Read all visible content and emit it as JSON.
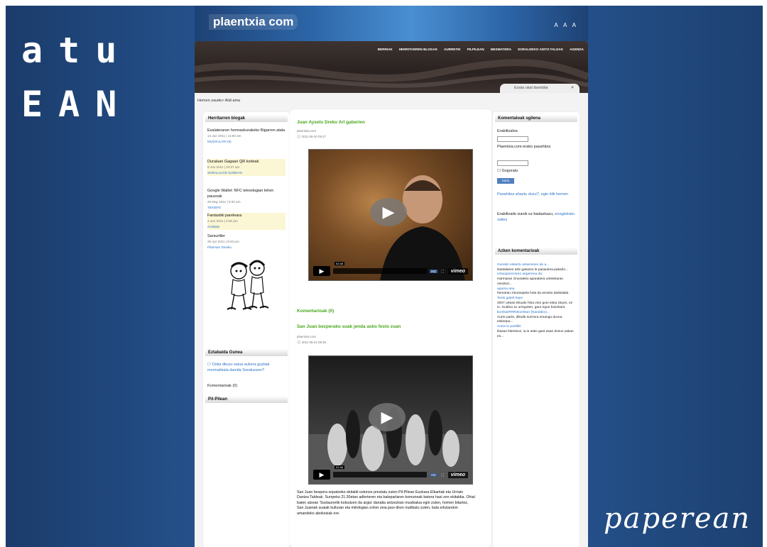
{
  "brand": {
    "line1": "atu",
    "line2": "EAN",
    "tagline": "paperean"
  },
  "header": {
    "logo": "plaentxia com",
    "textsize": "A A A"
  },
  "nav": [
    "BERRIAK",
    "HERRITARREN BLOGAK",
    "AURRETIK",
    "PILPILEAN",
    "MESMATERA",
    "SORALDEKO ADITZ-TALDAK",
    "AGENDA"
  ],
  "search": {
    "placeholder": "Ezata ukal danistlar"
  },
  "breadcrumb": "Hemen zaude> Aldi ama",
  "left": {
    "blogs_title": "Herritarren blogak",
    "posts": [
      {
        "title": "Esalateraren hormaskurakeko Bigarren atala",
        "date": "14 Jun 2011 | 11:00 am",
        "link": "MUSSULARI (5)",
        "hl": false
      },
      {
        "title": "Duralaan Gagaan QR kodeak",
        "date": "9 Jun 2011 | 10:37 am",
        "link": "SORALLUCE GUNEAN",
        "hl": true
      },
      {
        "title": "Google Wallet: NFC teknologian lehen pausoak",
        "date": "26 May 2011 | 8:30 am",
        "link": "TEKIEFE",
        "hl": false
      },
      {
        "title": "Fantastiki pareleara",
        "date": "3 Jun 2011 | 4:00 pm",
        "link": "Arrakiati",
        "hl": true
      },
      {
        "title": "Sarsurtiler",
        "date": "25 Apr 2011 | 8:40 pm",
        "link": "Pilarmas Tanako",
        "hl": false
      }
    ],
    "survey_title": "Eztabaida Gunea",
    "survey_question": "Ostia dituzu saioa aukera guztiak mormaikiala danida Soraluzeen?",
    "comments_count": "Komentarioak (0)",
    "pilpilean_title": "Pil-Pilean"
  },
  "main": {
    "post1": {
      "title": "Juan Aysets Dreko Arl gaberien",
      "author": "plaentxia.com",
      "date": "2011-06-20 09:27"
    },
    "video1": {
      "time": "02:48",
      "hd": "HD",
      "brand": "vimeo"
    },
    "comments": "Komentarioak (0)",
    "post2": {
      "title": "San Juan bezperako suak jenda asko festo zuan",
      "author": "plaentxia.com",
      "date": "2011-06-21 09:36"
    },
    "video2": {
      "time": "02:46",
      "hd": "HD",
      "brand": "vimeo"
    },
    "body": "San Juan bespera sopatzeko ekitaldi ostonse prestatu zuten Pil-Pilean Euskara Elkartiak eta Urrialo Dantza Taldeak. Surrpeko 21:30etan adlerteren eta baleparlaren komuneak batera hasi zen ekitaldia. Ohial baten alzean 'Sustaunetik kotsutzen da argia' danatia antzezkan musikalua egin zuten, homen bitartez, San Juaniak suaiak kulturan eta mitologian zoher zeia jaso diren irudikatu zuten, bala erliziarekin amandeko abokesiak ere."
  },
  "right": {
    "login_title": "Komentaloak sgilena",
    "user_label": "Erabiltzalea",
    "pass_label": "Plaentxia.com-erako pasahitza",
    "remember": "Gogoratu",
    "submit": "Sartu",
    "forgot": "Pasahitza ahaztu duzu?, egin klik hemen",
    "register_pre": "Erabiltzaile izanik ez badazkazu,",
    "register_link": "erregistratu zaitez",
    "recent_title": "Azken komentarioak",
    "recent": [
      {
        "a": "Gurekin eskertu arkarrenen de a...",
        "t": "Ikastalaren arte gatazeo le pasaulera pakarlo..."
      },
      {
        "a": "Urtaoparreraren argarrena da:",
        "t": "Harmaran zinuraleko aparatiera urtetekaran onezkol..."
      },
      {
        "a": "aparna ana",
        "t": "hemaran zinuraspela hola da arrantu dasbalala"
      },
      {
        "a": "Texts gatek-kaye",
        "t": "2007 urtean Ekualo hiria zine goni eitea zituen, ez in. Gudina 11 urregoten, gaur egun bazekara"
      },
      {
        "a": "korrikarRRRekorrikan (Naraldez)...",
        "t": "Aurre parte, dikoitk surrrera emango ducea eskerpur..."
      },
      {
        "a": "Aurra to partikki",
        "t": "Ikasaz kitentsoz, ia is asko gant asan dozun askan es..."
      }
    ]
  }
}
